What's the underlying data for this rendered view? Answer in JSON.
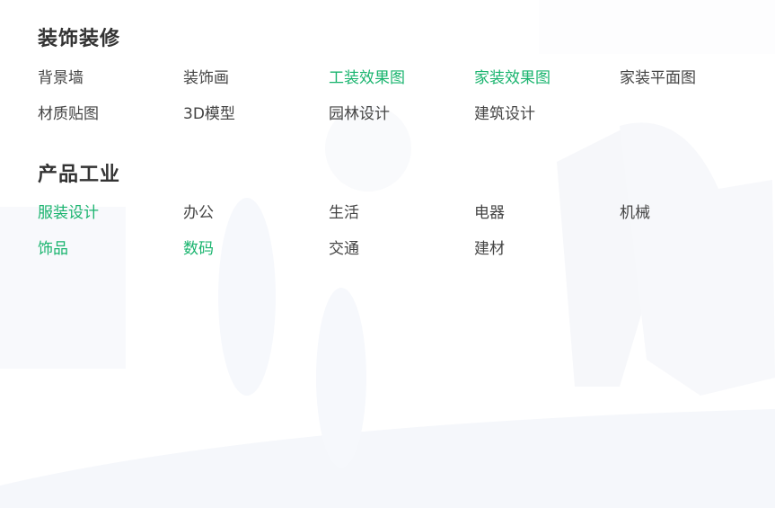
{
  "colors": {
    "title": "#333333",
    "link": "#444444",
    "highlight": "#19b46e",
    "background": "#ffffff"
  },
  "sections": [
    {
      "title": "装饰装修",
      "items": [
        {
          "label": "背景墙",
          "highlight": false
        },
        {
          "label": "装饰画",
          "highlight": false
        },
        {
          "label": "工装效果图",
          "highlight": true
        },
        {
          "label": "家装效果图",
          "highlight": true
        },
        {
          "label": "家装平面图",
          "highlight": false
        },
        {
          "label": "材质贴图",
          "highlight": false
        },
        {
          "label": "3D模型",
          "highlight": false
        },
        {
          "label": "园林设计",
          "highlight": false
        },
        {
          "label": "建筑设计",
          "highlight": false
        }
      ]
    },
    {
      "title": "产品工业",
      "items": [
        {
          "label": "服装设计",
          "highlight": true
        },
        {
          "label": "办公",
          "highlight": false
        },
        {
          "label": "生活",
          "highlight": false
        },
        {
          "label": "电器",
          "highlight": false
        },
        {
          "label": "机械",
          "highlight": false
        },
        {
          "label": "饰品",
          "highlight": true
        },
        {
          "label": "数码",
          "highlight": true
        },
        {
          "label": "交通",
          "highlight": false
        },
        {
          "label": "建材",
          "highlight": false
        }
      ]
    }
  ]
}
